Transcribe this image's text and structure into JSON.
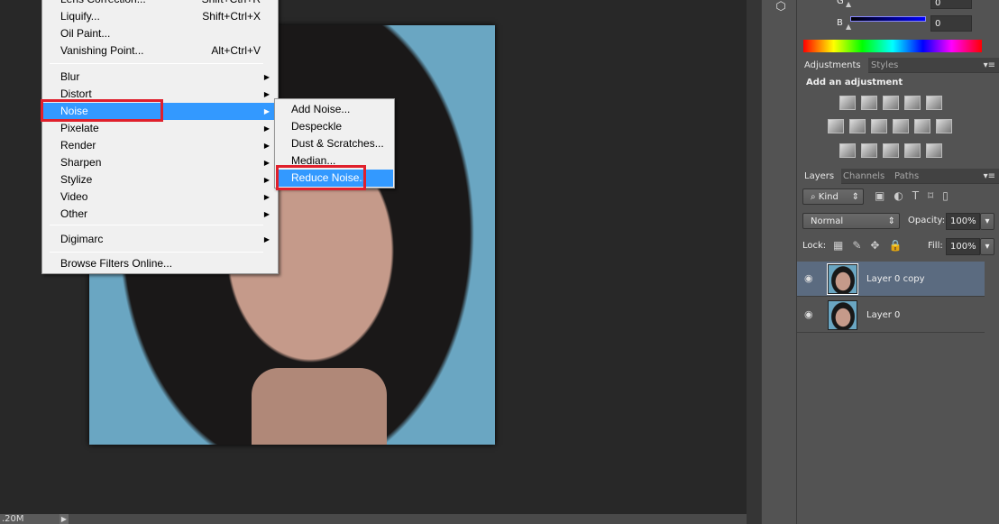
{
  "filter_menu": {
    "items": [
      {
        "label": "Lens Correction...",
        "shortcut": "Shift+Ctrl+R"
      },
      {
        "label": "Liquify...",
        "shortcut": "Shift+Ctrl+X"
      },
      {
        "label": "Oil Paint...",
        "shortcut": ""
      },
      {
        "label": "Vanishing Point...",
        "shortcut": "Alt+Ctrl+V"
      },
      {
        "label": "Blur",
        "submenu": true
      },
      {
        "label": "Distort",
        "submenu": true
      },
      {
        "label": "Noise",
        "submenu": true,
        "highlighted": true
      },
      {
        "label": "Pixelate",
        "submenu": true
      },
      {
        "label": "Render",
        "submenu": true
      },
      {
        "label": "Sharpen",
        "submenu": true
      },
      {
        "label": "Stylize",
        "submenu": true
      },
      {
        "label": "Video",
        "submenu": true
      },
      {
        "label": "Other",
        "submenu": true
      },
      {
        "label": "Digimarc",
        "submenu": true
      },
      {
        "label": "Browse Filters Online..."
      }
    ],
    "arrow": "▶"
  },
  "noise_submenu": {
    "items": [
      {
        "label": "Add Noise..."
      },
      {
        "label": "Despeckle"
      },
      {
        "label": "Dust & Scratches..."
      },
      {
        "label": "Median..."
      },
      {
        "label": "Reduce Noise..",
        "highlighted": true
      }
    ]
  },
  "color_panel": {
    "g_label": "G",
    "g_value": "0",
    "b_label": "B",
    "b_value": "0"
  },
  "adjustments_panel": {
    "tabs": [
      "Adjustments",
      "Styles"
    ],
    "title": "Add an adjustment"
  },
  "layers_panel": {
    "tabs": [
      "Layers",
      "Channels",
      "Paths"
    ],
    "filter_kind": "Kind",
    "blend_mode": "Normal",
    "opacity_label": "Opacity:",
    "opacity": "100%",
    "lock_label": "Lock:",
    "fill_label": "Fill:",
    "fill": "100%",
    "layers": [
      {
        "name": "Layer 0 copy",
        "selected": true
      },
      {
        "name": "Layer 0",
        "selected": false
      }
    ]
  },
  "status_bar": {
    "doc_size": ".20M"
  },
  "colors": {
    "highlight": "#3399ff",
    "annotation": "#e0202c",
    "panel": "#535353",
    "canvas": "#282828"
  }
}
